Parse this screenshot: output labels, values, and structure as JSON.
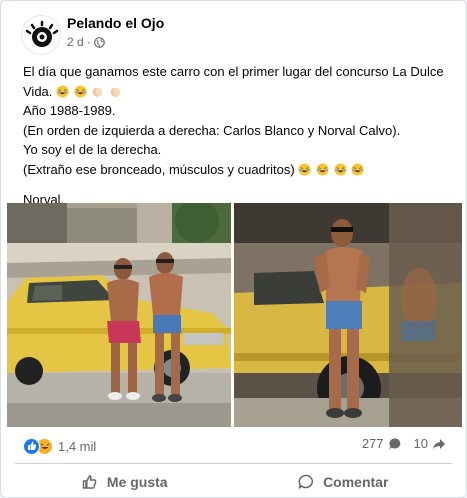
{
  "post": {
    "page_name": "Pelando el Ojo",
    "time": "2 d",
    "separator": "·",
    "privacy_icon": "globe-icon",
    "lines": {
      "line1": "El día que ganamos este carro con el primer lugar del concurso La Dulce Vida.",
      "line2": "Año 1988-1989.",
      "line3": "(En orden de izquierda a derecha: Carlos Blanco y Norval Calvo).",
      "line4": "Yo soy el de la derecha.",
      "line5": "(Extraño ese bronceado, músculos y cuadritos)",
      "line6": "Norval."
    },
    "emojis": {
      "line1": [
        "laughing-emoji",
        "laughing-emoji",
        "clapping-emoji",
        "clapping-emoji"
      ],
      "line5": [
        "laughing-emoji",
        "laughing-emoji",
        "laughing-emoji",
        "laughing-emoji"
      ]
    }
  },
  "photos": [
    {
      "description_icon": "photo-two-men-yellow-car"
    },
    {
      "description_icon": "photo-man-yellow-car"
    }
  ],
  "footer": {
    "reaction_icons": [
      "like-icon",
      "haha-icon"
    ],
    "reaction_count": "1,4 mil",
    "comments_count": "277",
    "shares_count": "10",
    "like_label": "Me gusta",
    "comment_label": "Comentar"
  },
  "colors": {
    "accent": "#1877f2",
    "secondary_text": "#65676b",
    "car_yellow": "#e8c84a"
  }
}
